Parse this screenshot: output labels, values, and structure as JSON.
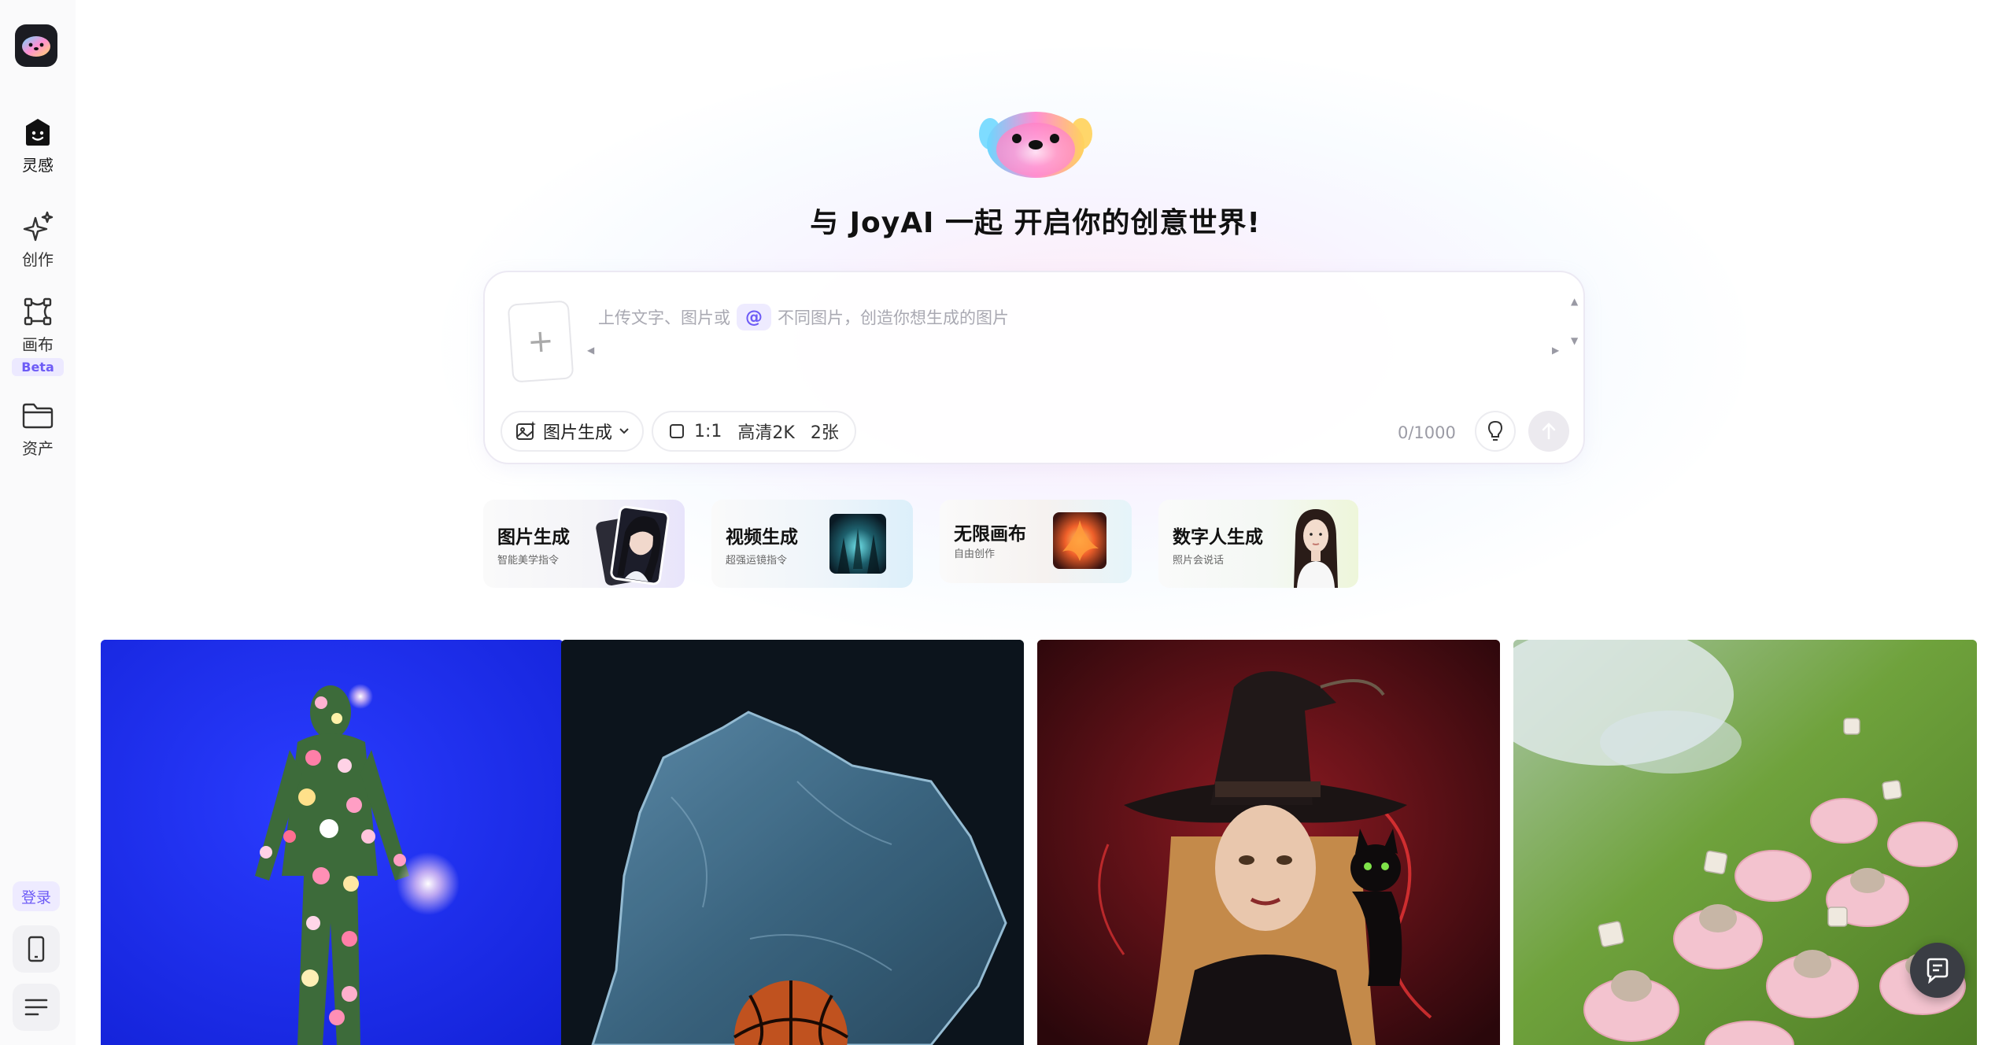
{
  "sidebar": {
    "items": [
      {
        "label": "灵感",
        "icon": "inspiration-icon"
      },
      {
        "label": "创作",
        "icon": "sparkle-icon"
      },
      {
        "label": "画布",
        "icon": "canvas-icon",
        "badge": "Beta"
      },
      {
        "label": "资产",
        "icon": "folder-icon"
      }
    ],
    "login_label": "登录"
  },
  "hero": {
    "title": "与 JoyAI 一起 开启你的创意世界!"
  },
  "prompt": {
    "placeholder_before": "上传文字、图片或",
    "at_symbol": "@",
    "placeholder_after": "不同图片，创造你想生成的图片",
    "mode_label": "图片生成",
    "ratio": "1:1",
    "quality": "高清2K",
    "count": "2张",
    "char_counter": "0/1000"
  },
  "features": [
    {
      "title": "图片生成",
      "subtitle": "智能美学指令"
    },
    {
      "title": "视频生成",
      "subtitle": "超强运镜指令"
    },
    {
      "title": "无限画布",
      "subtitle": "自由创作"
    },
    {
      "title": "数字人生成",
      "subtitle": "照片会说话"
    }
  ],
  "colors": {
    "accent": "#6d5bf6",
    "accent_bg": "#eeebff",
    "sidebar_bg": "#fafafb"
  }
}
